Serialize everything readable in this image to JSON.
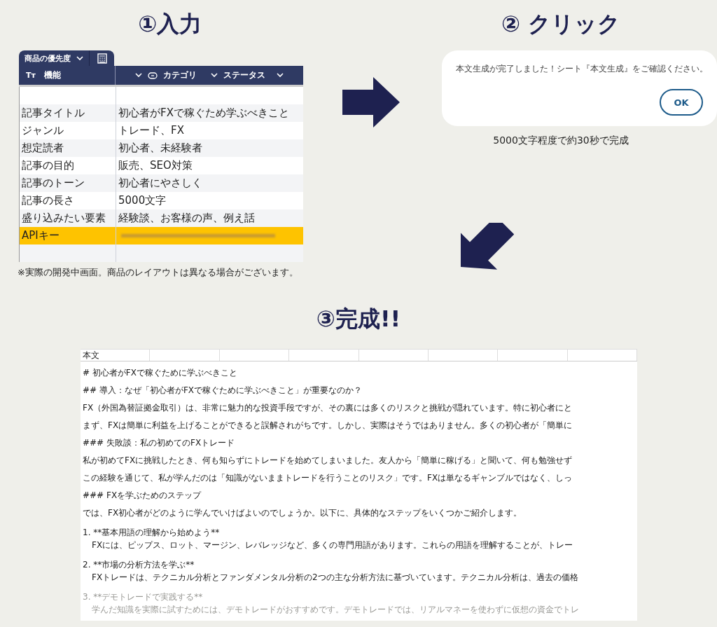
{
  "input_step": {
    "title": "①入力",
    "tabs": [
      {
        "label": "商品の優先度",
        "selected": true
      }
    ],
    "columns": [
      {
        "label": "機能",
        "kind": "text",
        "type_icon": "Tт"
      },
      {
        "label": "カテゴリ",
        "kind": "select"
      },
      {
        "label": "ステータス",
        "kind": "status"
      }
    ],
    "rows": [
      {
        "label": "",
        "value": "",
        "highlighted": false,
        "masked": false
      },
      {
        "label": "記事タイトル",
        "value": "初心者がFXで稼ぐため学ぶべきこと",
        "highlighted": false,
        "masked": false
      },
      {
        "label": "ジャンル",
        "value": "トレード、FX",
        "highlighted": false,
        "masked": false
      },
      {
        "label": "想定読者",
        "value": "初心者、未経験者",
        "highlighted": false,
        "masked": false
      },
      {
        "label": "記事の目的",
        "value": "販売、SEO対策",
        "highlighted": false,
        "masked": false
      },
      {
        "label": "記事のトーン",
        "value": "初心者にやさしく",
        "highlighted": false,
        "masked": false
      },
      {
        "label": "記事の長さ",
        "value": "5000文字",
        "highlighted": false,
        "masked": false
      },
      {
        "label": "盛り込みたい要素",
        "value": "経験談、お客様の声、例え話",
        "highlighted": false,
        "masked": false
      },
      {
        "label": "APIキー",
        "value": "",
        "highlighted": true,
        "masked": true
      },
      {
        "label": "",
        "value": "",
        "highlighted": false,
        "masked": false
      }
    ],
    "note": "※実際の開発中画面。商品のレイアウトは異なる場合がございます。"
  },
  "click_step": {
    "title": "② クリック",
    "dialog": {
      "message": "本文生成が完了しました！シート『本文生成』をご確認ください。",
      "button": "OK"
    },
    "caption": "5000文字程度で約30秒で完成"
  },
  "result_step": {
    "title": "③完成!!",
    "sheet": {
      "header": "本文",
      "lines": [
        {
          "text": "# 初心者がFXで稼ぐために学ぶべきこと",
          "kind": "para",
          "faded": false
        },
        {
          "text": "## 導入：なぜ「初心者がFXで稼ぐために学ぶべきこと」が重要なのか？",
          "kind": "para",
          "faded": false
        },
        {
          "text": "FX（外国為替証拠金取引）は、非常に魅力的な投資手段ですが、その裏には多くのリスクと挑戦が隠れています。特に初心者にと",
          "kind": "para",
          "faded": false
        },
        {
          "text": "まず、FXは簡単に利益を上げることができると誤解されがちです。しかし、実際はそうではありません。多くの初心者が「簡単に",
          "kind": "para",
          "faded": false
        },
        {
          "text": "### 失敗談：私の初めてのFXトレード",
          "kind": "para",
          "faded": false
        },
        {
          "text": "私が初めてFXに挑戦したとき、何も知らずにトレードを始めてしまいました。友人から「簡単に稼げる」と聞いて、何も勉強せず",
          "kind": "para",
          "faded": false
        },
        {
          "text": "この経験を通じて、私が学んだのは「知識がないままトレードを行うことのリスク」です。FXは単なるギャンブルではなく、しっ",
          "kind": "para",
          "faded": false
        },
        {
          "text": "### FXを学ぶためのステップ",
          "kind": "para",
          "faded": false
        },
        {
          "text": "では、FX初心者がどのように学んでいけばよいのでしょうか。以下に、具体的なステップをいくつかご紹介します。",
          "kind": "para",
          "faded": false
        },
        {
          "text": "1. **基本用語の理解から始めよう**",
          "kind": "item",
          "faded": false
        },
        {
          "text": "FXには、ピップス、ロット、マージン、レバレッジなど、多くの専門用語があります。これらの用語を理解することが、トレー",
          "kind": "detail",
          "faded": false
        },
        {
          "text": "2. **市場の分析方法を学ぶ**",
          "kind": "item",
          "faded": false
        },
        {
          "text": "FXトレードは、テクニカル分析とファンダメンタル分析の2つの主な分析方法に基づいています。テクニカル分析は、過去の価格",
          "kind": "detail",
          "faded": false
        },
        {
          "text": "3. **デモトレードで実践する**",
          "kind": "item",
          "faded": true
        },
        {
          "text": "学んだ知識を実際に試すためには、デモトレードがおすすめです。デモトレードでは、リアルマネーを使わずに仮想の資金でトレ",
          "kind": "detail",
          "faded": true
        }
      ]
    }
  }
}
